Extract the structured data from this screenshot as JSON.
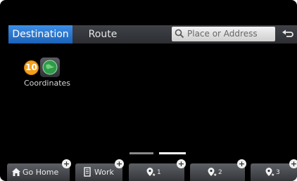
{
  "header": {
    "tab_destination": "Destination",
    "tab_route": "Route",
    "search_placeholder": "Place or Address"
  },
  "apps": [
    {
      "label": "Coordinates",
      "callout": "10",
      "icon": "globe-icon"
    }
  ],
  "pager": {
    "pages": 2,
    "current": 2
  },
  "quick_bar": [
    {
      "label": "Go Home",
      "icon": "home-icon"
    },
    {
      "label": "Work",
      "icon": "building-icon"
    },
    {
      "label": "1",
      "icon": "star-pin-icon"
    },
    {
      "label": "2",
      "icon": "star-pin-icon"
    },
    {
      "label": "3",
      "icon": "star-pin-icon"
    }
  ],
  "colors": {
    "accent": "#1b62b8",
    "background": "#000000",
    "callout": "#f3a01b"
  }
}
